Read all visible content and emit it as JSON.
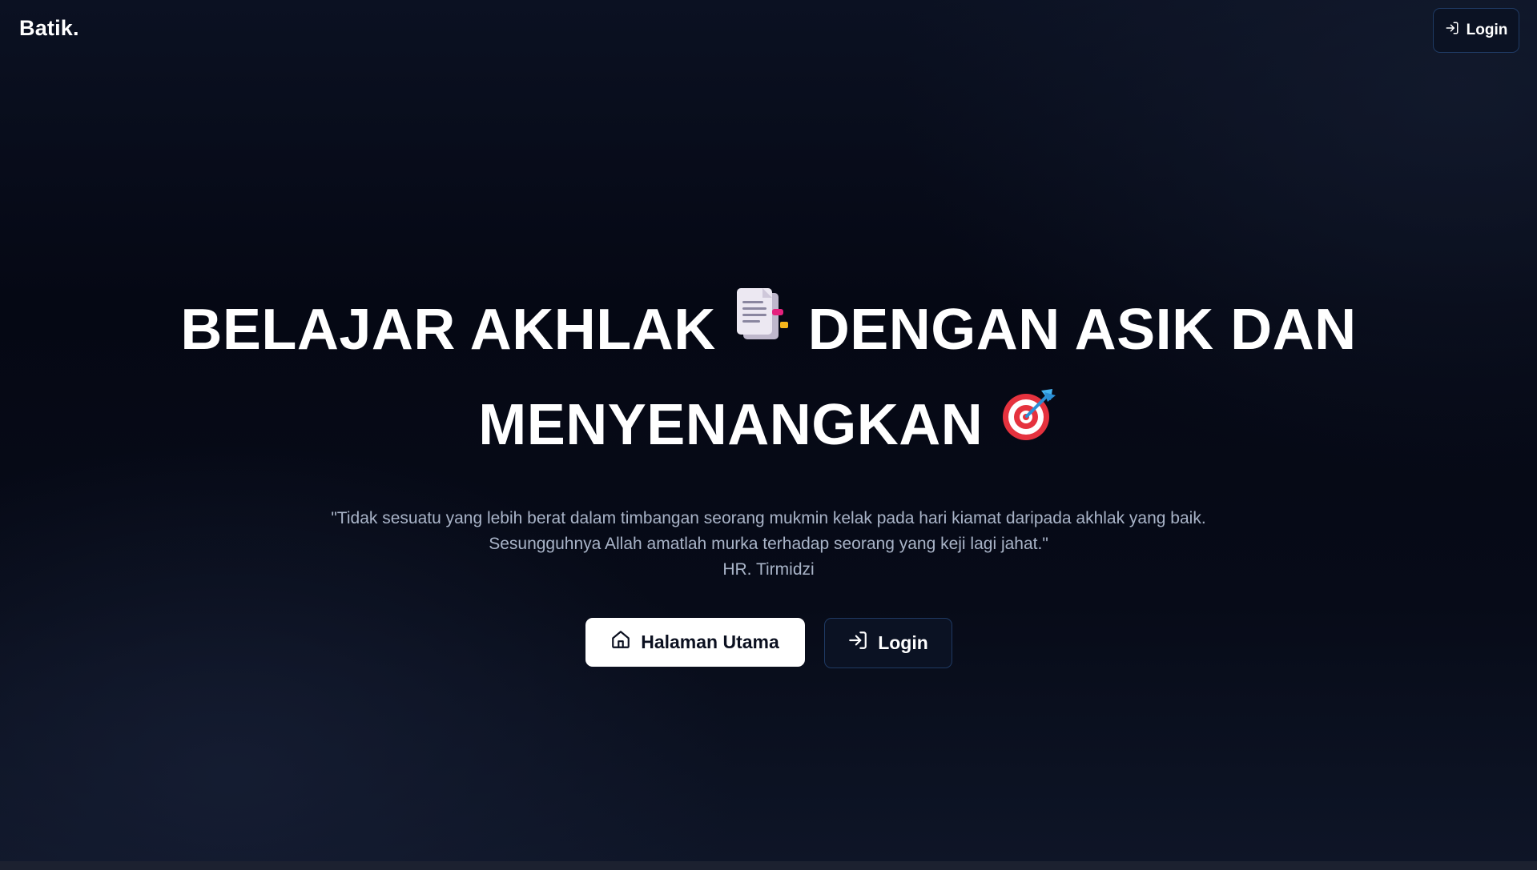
{
  "brand": {
    "name": "Batik."
  },
  "nav": {
    "login_label": "Login",
    "login_icon": "login-arrow-icon"
  },
  "hero": {
    "headline_part1": "BELAJAR AKHLAK",
    "headline_part2": "DENGAN ASIK DAN",
    "headline_part3": "MENYENANGKAN",
    "emoji_1": "document-emoji-icon",
    "emoji_2": "target-dart-emoji-icon",
    "quote": "\"Tidak sesuatu yang lebih berat dalam timbangan seorang mukmin kelak pada hari kiamat daripada akhlak yang baik. Sesungguhnya Allah amatlah murka terhadap seorang yang keji lagi jahat.\"",
    "source": "HR. Tirmidzi"
  },
  "actions": {
    "home_label": "Halaman Utama",
    "home_icon": "home-icon",
    "login_label": "Login",
    "login_icon": "login-arrow-icon"
  },
  "colors": {
    "background": "#060a16",
    "text_primary": "#ffffff",
    "text_muted": "#a9b4c8",
    "button_border": "#1f3a63"
  }
}
